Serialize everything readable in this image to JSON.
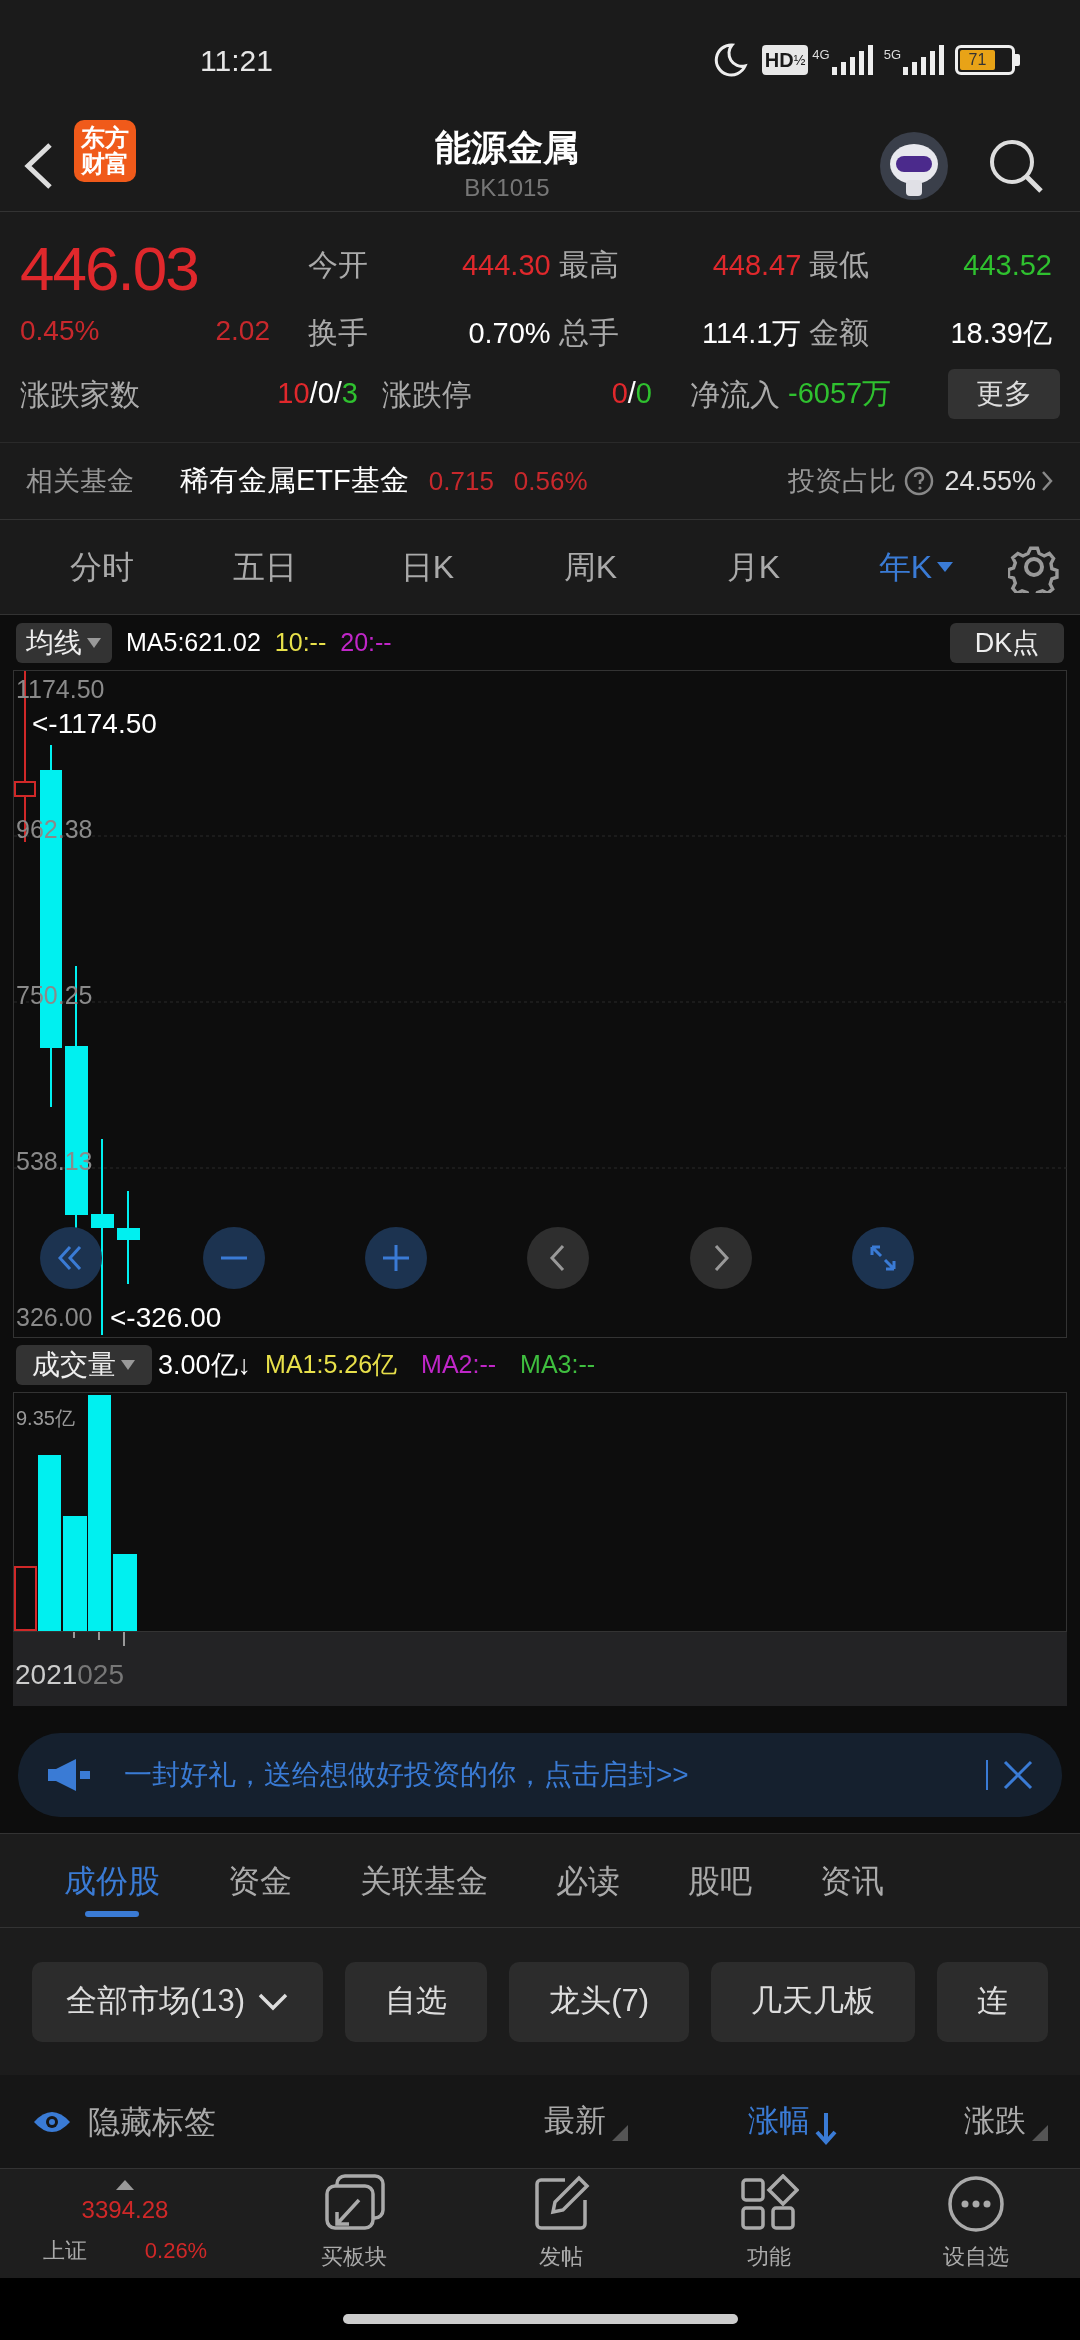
{
  "status_bar": {
    "time": "11:21",
    "hd": "HD",
    "hd_fraction": "½",
    "network_1": "4G",
    "network_2": "5G",
    "battery": "71"
  },
  "header": {
    "logo": "东方财富",
    "title": "能源金属",
    "code": "BK1015"
  },
  "quote": {
    "price": "446.03",
    "change_pct": "0.45%",
    "change": "2.02",
    "stats": [
      {
        "label": "今开",
        "value": "444.30",
        "color": "#e0282c"
      },
      {
        "label": "最高",
        "value": "448.47",
        "color": "#e0282c"
      },
      {
        "label": "最低",
        "value": "443.52",
        "color": "#2fc12f"
      },
      {
        "label": "换手",
        "value": "0.70%",
        "color": "#ffffff"
      },
      {
        "label": "总手",
        "value": "114.1万",
        "color": "#ffffff"
      },
      {
        "label": "金额",
        "value": "18.39亿",
        "color": "#ffffff"
      }
    ],
    "breadth": {
      "label": "涨跌家数",
      "parts": [
        {
          "text": "10",
          "color": "#e0282c"
        },
        {
          "text": "/",
          "color": "#ffffff"
        },
        {
          "text": "0",
          "color": "#ffffff"
        },
        {
          "text": "/",
          "color": "#ffffff"
        },
        {
          "text": "3",
          "color": "#2fc12f"
        }
      ]
    },
    "limits": {
      "label": "涨跌停",
      "parts": [
        {
          "text": "0",
          "color": "#e0282c"
        },
        {
          "text": "/",
          "color": "#ffffff"
        },
        {
          "text": "0",
          "color": "#2fc12f"
        }
      ]
    },
    "net_inflow": {
      "label": "净流入",
      "value": "-6057万"
    },
    "more_button": "更多"
  },
  "related_fund": {
    "label": "相关基金",
    "name": "稀有金属ETF基金",
    "price": "0.715",
    "pct": "0.56%",
    "ratio_label": "投资占比",
    "ratio": "24.55%"
  },
  "period_tabs": [
    {
      "label": "分时",
      "selected": false
    },
    {
      "label": "五日",
      "selected": false
    },
    {
      "label": "日K",
      "selected": false
    },
    {
      "label": "周K",
      "selected": false
    },
    {
      "label": "月K",
      "selected": false
    },
    {
      "label": "年K",
      "selected": true
    }
  ],
  "price_chart": {
    "indicator": "均线",
    "ma": [
      {
        "text": "MA5:621.02",
        "color": "#ffffff"
      },
      {
        "text": "10:--",
        "color": "#e8e04a"
      },
      {
        "text": "20:--",
        "color": "#c026c8"
      }
    ],
    "dk_button": "DK点",
    "y_labels": [
      "1174.50",
      "962.38",
      "750.25",
      "538.13",
      "326.00"
    ],
    "high_marker": "<-1174.50",
    "low_marker": "<-326.00"
  },
  "volume_chart": {
    "indicator": "成交量",
    "current": "3.00亿↓",
    "ma": [
      {
        "text": "MA1:5.26亿",
        "color": "#e8e04a"
      },
      {
        "text": "MA2:--",
        "color": "#c026c8"
      },
      {
        "text": "MA3:--",
        "color": "#3fbf3f"
      }
    ],
    "max_label": "9.35亿",
    "x_labels": [
      "2021",
      "025"
    ]
  },
  "banner": {
    "text": "一封好礼，送给想做好投资的你，点击启封>>"
  },
  "section_tabs": [
    {
      "label": "成份股",
      "selected": true
    },
    {
      "label": "资金",
      "selected": false
    },
    {
      "label": "关联基金",
      "selected": false
    },
    {
      "label": "必读",
      "selected": false
    },
    {
      "label": "股吧",
      "selected": false
    },
    {
      "label": "资讯",
      "selected": false
    }
  ],
  "filters": [
    {
      "label": "全部市场(13)",
      "kind": "dropdown"
    },
    {
      "label": "自选",
      "kind": "chip"
    },
    {
      "label": "龙头(7)",
      "kind": "chip"
    },
    {
      "label": "几天几板",
      "kind": "chip"
    },
    {
      "label": "连",
      "kind": "chip"
    }
  ],
  "sort_bar": {
    "hide_tags": "隐藏标签",
    "columns": [
      {
        "label": "最新",
        "selected": false
      },
      {
        "label": "涨幅",
        "selected": true
      },
      {
        "label": "涨跌",
        "selected": false
      }
    ]
  },
  "bottom_nav": {
    "index": {
      "value": "3394.28",
      "name": "上证",
      "pct": "0.26%"
    },
    "items": [
      {
        "label": "买板块"
      },
      {
        "label": "发帖"
      },
      {
        "label": "功能"
      },
      {
        "label": "设自选"
      }
    ]
  }
}
